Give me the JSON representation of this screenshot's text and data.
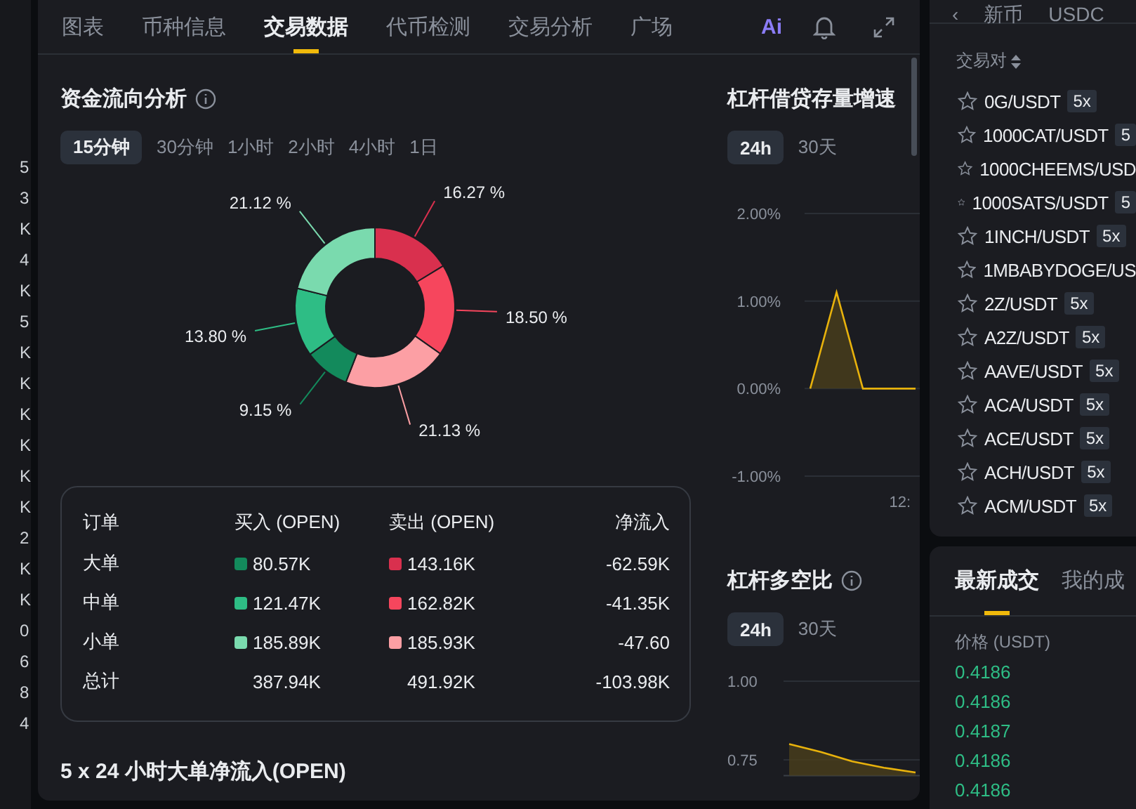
{
  "left_strip": {
    "items": [
      "5",
      "3",
      "K",
      "4",
      "K",
      "5",
      "K",
      "K",
      "K",
      "K",
      "K",
      "K",
      "2",
      "K",
      "K",
      "0",
      "6",
      "8",
      "4"
    ]
  },
  "tabs": [
    {
      "label": "图表",
      "selected": false
    },
    {
      "label": "币种信息",
      "selected": false
    },
    {
      "label": "交易数据",
      "selected": true
    },
    {
      "label": "代币检测",
      "selected": false
    },
    {
      "label": "交易分析",
      "selected": false
    },
    {
      "label": "广场",
      "selected": false
    }
  ],
  "ai_badge": "Ai",
  "fund_flow": {
    "title": "资金流向分析",
    "periods": [
      {
        "label": "15分钟",
        "selected": true
      },
      {
        "label": "30分钟",
        "selected": false
      },
      {
        "label": "1小时",
        "selected": false
      },
      {
        "label": "2小时",
        "selected": false
      },
      {
        "label": "4小时",
        "selected": false
      },
      {
        "label": "1日",
        "selected": false
      }
    ],
    "chart_data": {
      "type": "donut",
      "values": [
        16.27,
        18.5,
        21.13,
        9.15,
        13.8,
        21.12
      ],
      "data_labels": "value_labels",
      "value_labels": [
        "16.27 %",
        "18.50 %",
        "21.13 %",
        "9.15 %",
        "13.80 %",
        "21.12 %"
      ]
    },
    "table": {
      "columns": [
        "订单",
        "买入 (OPEN)",
        "卖出 (OPEN)",
        "净流入"
      ],
      "rows": [
        {
          "kind": "order",
          "label": "大单",
          "buy": {
            "text": "80.57K",
            "color": "#138a5c"
          },
          "sell": {
            "text": "143.16K",
            "color": "#d9304e"
          },
          "net": "-62.59K"
        },
        {
          "kind": "order",
          "label": "中单",
          "buy": {
            "text": "121.47K",
            "color": "#2ebd85"
          },
          "sell": {
            "text": "162.82K",
            "color": "#f6465d"
          },
          "net": "-41.35K"
        },
        {
          "kind": "order",
          "label": "小单",
          "buy": {
            "text": "185.89K",
            "color": "#7adaae"
          },
          "sell": {
            "text": "185.93K",
            "color": "#fc9fa4"
          },
          "net": "-47.60"
        },
        {
          "kind": "total",
          "label": "总计",
          "buy": {
            "text": "387.94K"
          },
          "sell": {
            "text": "491.92K"
          },
          "net": "-103.98K"
        }
      ]
    },
    "next_title": "5 x 24 小时大单净流入(OPEN)"
  },
  "margin_growth": {
    "title": "杠杆借贷存量增速",
    "periods": [
      {
        "label": "24h",
        "selected": true
      },
      {
        "label": "30天",
        "selected": false
      }
    ],
    "chart_data": {
      "type": "area",
      "values": [
        0,
        1.1,
        0,
        0,
        0
      ],
      "ylim": [
        -1,
        2
      ],
      "yticks": [
        {
          "value": 2,
          "label": "2.00%"
        },
        {
          "value": 1,
          "label": "1.00%"
        },
        {
          "value": 0,
          "label": "0.00%"
        },
        {
          "value": -1,
          "label": "-1.00%"
        }
      ]
    },
    "x_axis_text": "12:"
  },
  "long_short": {
    "title": "杠杆多空比",
    "periods": [
      {
        "label": "24h",
        "selected": true
      },
      {
        "label": "30天",
        "selected": false
      }
    ],
    "chart_data": {
      "type": "area",
      "values": [
        0.8,
        0.775,
        0.745,
        0.725,
        0.71
      ],
      "ylim": [
        0.7,
        1
      ],
      "yticks": [
        {
          "value": 1,
          "label": "1.00"
        },
        {
          "value": 0.75,
          "label": "0.75"
        }
      ]
    }
  },
  "pairs_panel": {
    "top_tabs": [
      "‹",
      "新币",
      "USDC"
    ],
    "column": "交易对",
    "pairs": [
      {
        "name": "0G/USDT",
        "badge": "5x"
      },
      {
        "name": "1000CAT/USDT",
        "badge": "5"
      },
      {
        "name": "1000CHEEMS/USD"
      },
      {
        "name": "1000SATS/USDT",
        "badge": "5"
      },
      {
        "name": "1INCH/USDT",
        "badge": "5x"
      },
      {
        "name": "1MBABYDOGE/US"
      },
      {
        "name": "2Z/USDT",
        "badge": "5x"
      },
      {
        "name": "A2Z/USDT",
        "badge": "5x"
      },
      {
        "name": "AAVE/USDT",
        "badge": "5x"
      },
      {
        "name": "ACA/USDT",
        "badge": "5x"
      },
      {
        "name": "ACE/USDT",
        "badge": "5x"
      },
      {
        "name": "ACH/USDT",
        "badge": "5x"
      },
      {
        "name": "ACM/USDT",
        "badge": "5x"
      }
    ]
  },
  "trades_panel": {
    "tabs": [
      {
        "label": "最新成交",
        "selected": true
      },
      {
        "label": "我的成",
        "selected": false
      }
    ],
    "column": "价格 (USDT)",
    "prices": [
      "0.4186",
      "0.4186",
      "0.4187",
      "0.4186",
      "0.4186"
    ]
  }
}
